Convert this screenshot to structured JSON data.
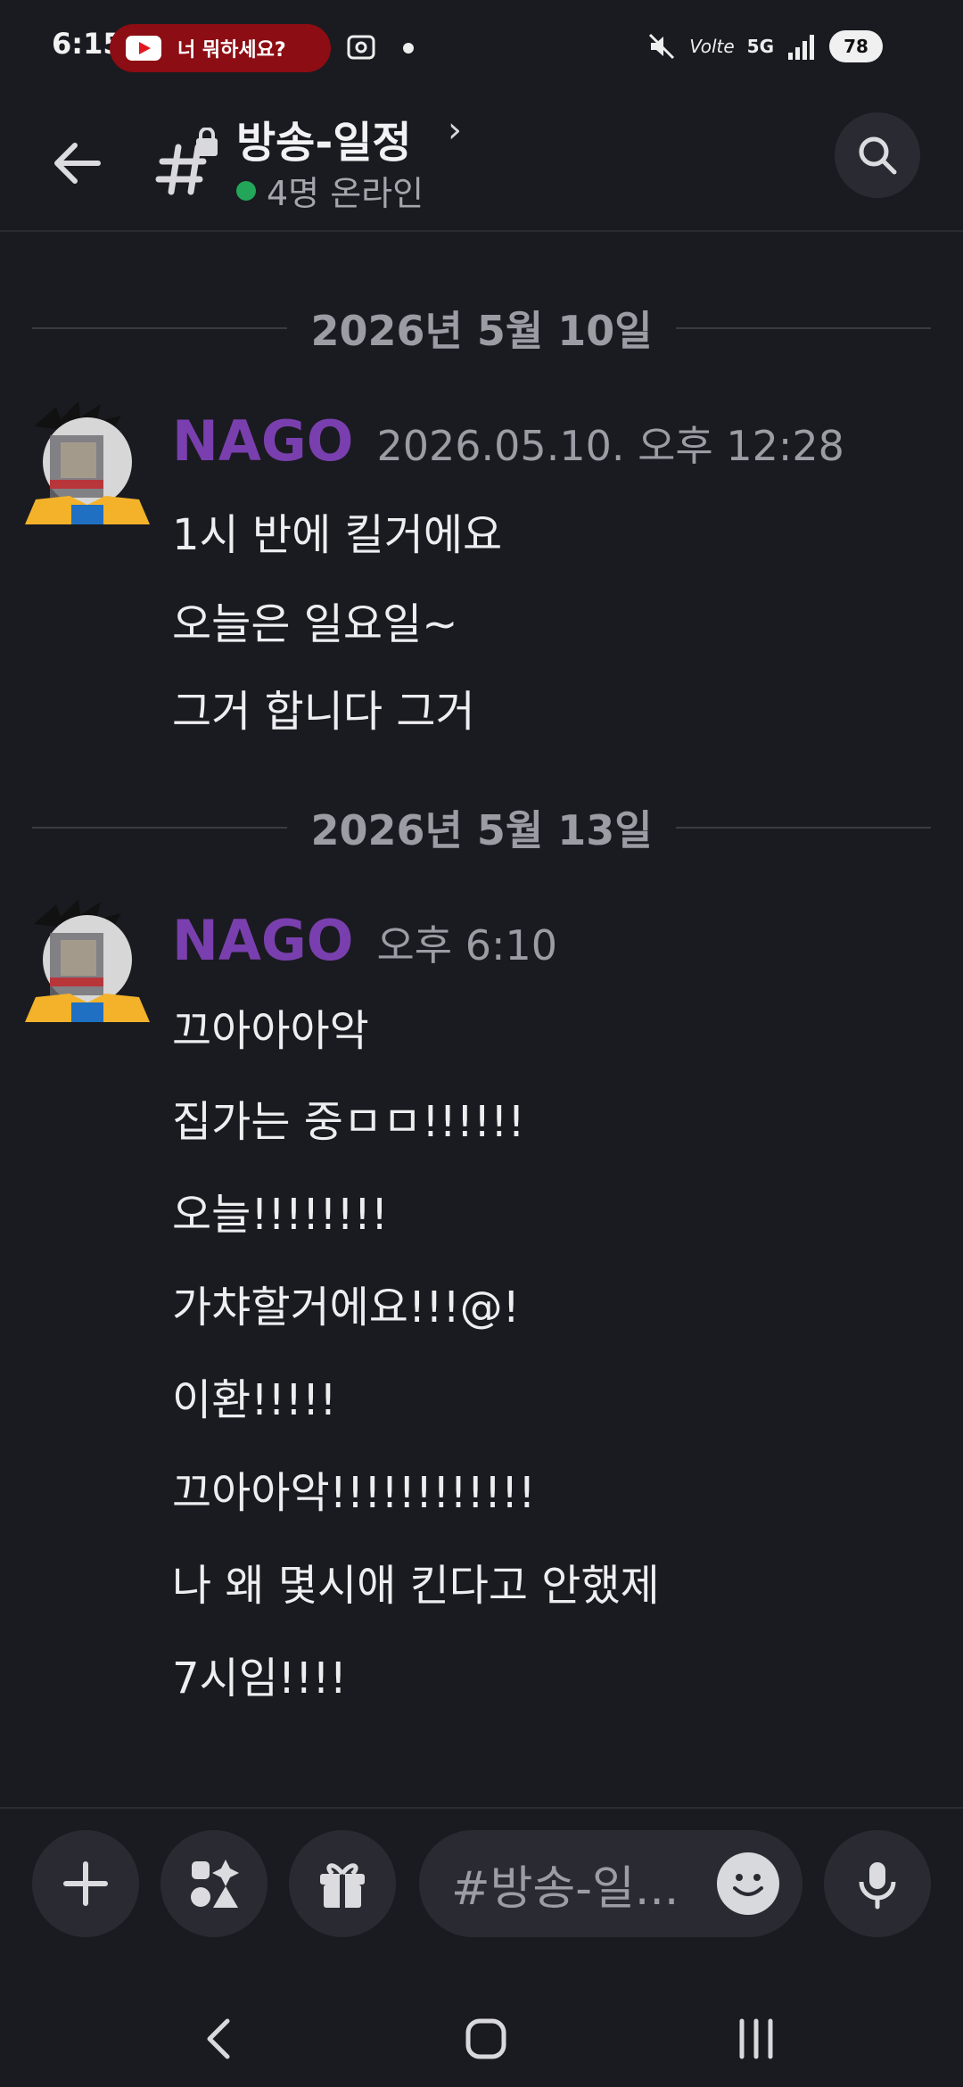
{
  "status": {
    "time": "6:15",
    "notification_pill_text": "너 뭐하세요?",
    "volte": "Volte",
    "network": "5G",
    "battery": "78"
  },
  "header": {
    "channel_title": "방송-일정",
    "online_text": "4명 온라인"
  },
  "dates": [
    "2026년 5월 10일",
    "2026년 5월 13일"
  ],
  "messages": [
    {
      "username": "NAGO",
      "timestamp": "2026.05.10. 오후 12:28",
      "lines": [
        "1시 반에 킬거에요",
        "오늘은 일요일~",
        "그거 합니다 그거"
      ]
    },
    {
      "username": "NAGO",
      "timestamp": "오후 6:10",
      "lines": [
        "끄아아아악",
        "집가는 중ㅁㅁ!!!!!!",
        "오늘!!!!!!!!",
        "가챠할거에요!!!@!",
        "이환!!!!!",
        "끄아아악!!!!!!!!!!!!",
        "나 왜 몇시애 킨다고 안했제",
        "7시임!!!!"
      ]
    }
  ],
  "composer": {
    "placeholder": "#방송-일..."
  },
  "colors": {
    "background": "#1a1b20",
    "username": "#7a3fae",
    "online": "#23a55a"
  }
}
